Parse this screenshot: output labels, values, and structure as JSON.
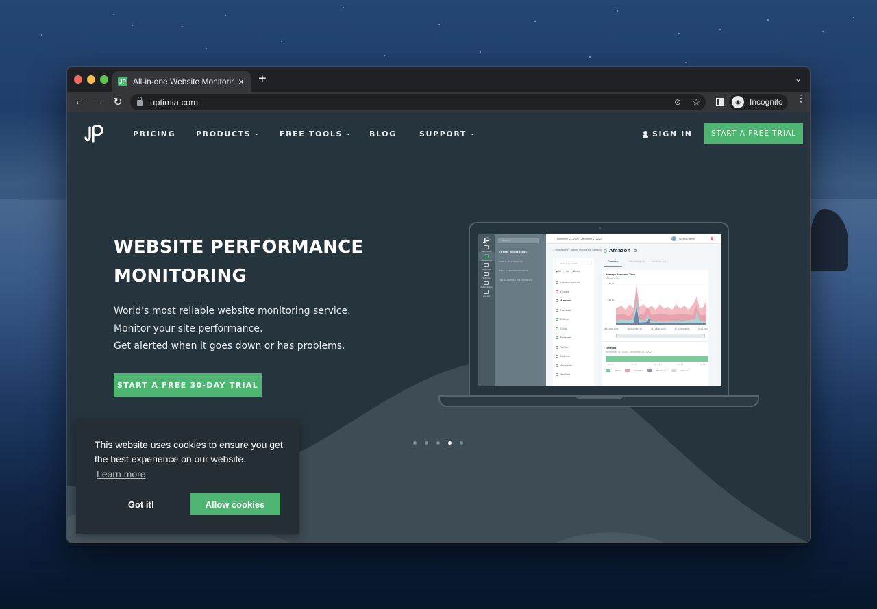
{
  "browser": {
    "tab_title": "All-in-one Website Monitoring",
    "tab_favicon_text": "JP",
    "url": "uptimia.com",
    "profile_label": "Incognito",
    "icons": {
      "close": "×",
      "new_tab": "+",
      "tab_list": "⌄",
      "back": "←",
      "forward": "→",
      "reload": "↻",
      "eye_off": "⊘",
      "star": "☆",
      "menu": "⋮",
      "incognito": "◉"
    }
  },
  "site": {
    "brand_color": "#4eb573",
    "background_color": "#26343e",
    "nav": [
      {
        "label": "PRICING",
        "has_dropdown": false
      },
      {
        "label": "PRODUCTS",
        "has_dropdown": true
      },
      {
        "label": "FREE TOOLS",
        "has_dropdown": true
      },
      {
        "label": "BLOG",
        "has_dropdown": false
      },
      {
        "label": "SUPPORT",
        "has_dropdown": true
      }
    ],
    "chevron": "⌄",
    "sign_in": "SIGN IN",
    "cta_top": "START A FREE TRIAL",
    "hero": {
      "title_line1": "WEBSITE PERFORMANCE",
      "title_line2": "MONITORING",
      "sub_lines": [
        "World's most reliable website monitoring service.",
        "Monitor your site performance.",
        "Get alerted when it goes down or has problems."
      ],
      "cta": "START A FREE 30-DAY TRIAL"
    },
    "carousel": {
      "total": 5,
      "active_index": 3
    }
  },
  "mockup": {
    "rail_items": [
      "Dashboard",
      "Monitoring",
      "Reporting",
      "Settings",
      "Subscription",
      "Log out"
    ],
    "search_placeholder": "Search",
    "menu_items": [
      "UPTIME MONITORING",
      "SPEED MONITORING",
      "REAL USER MONITORING",
      "TRANSACTION MONITORING"
    ],
    "date_range": "November 24, 2020 - December 1, 2020",
    "user": "Uptimia Demo",
    "breadcrumb": [
      "Monitoring",
      "Uptime monitoring",
      "Amazon"
    ],
    "list_search": "Search by name...",
    "filters": [
      "All",
      "Up",
      "Down"
    ],
    "monitors": [
      {
        "name": "ADD NEW MONITOR",
        "status": "add"
      },
      {
        "name": "Google",
        "status": "down"
      },
      {
        "name": "Amazon",
        "status": "up"
      },
      {
        "name": "Facebook",
        "status": "up"
      },
      {
        "name": "Github",
        "status": "up"
      },
      {
        "name": "GMail",
        "status": "up"
      },
      {
        "name": "Pinterest",
        "status": "up"
      },
      {
        "name": "Twitter",
        "status": "up"
      },
      {
        "name": "Uptimia",
        "status": "up"
      },
      {
        "name": "Wikipedia",
        "status": "up"
      },
      {
        "name": "YouTube",
        "status": "up"
      }
    ],
    "monitor_title": "Amazon",
    "tabs": [
      "Summary",
      "Monitoring log",
      "Incidents log"
    ],
    "chart_title": "Average Response Time",
    "chart_unit": "Milliseconds",
    "y_ticks": [
      "150 ms",
      "100 ms"
    ],
    "x_ticks": [
      "26.11.2020 12:00",
      "28.11.2020 01:00",
      "29.11.2020 12:00",
      "01.12.2020 00:00",
      "01.12.2020"
    ],
    "timeline_title": "Timeline",
    "timeline_range": "November 24, 2020 - December 01, 2020",
    "timeline_ticks": [
      "Nov 25",
      "Nov 26",
      "Nov 28",
      "Nov 29",
      "Nov 30"
    ],
    "legend": [
      "Uptime",
      "Downtime",
      "Maintenance",
      "Unknown"
    ]
  },
  "cookie": {
    "message": "This website uses cookies to ensure you get the best experience on our website.",
    "learn_more": "Learn more",
    "dismiss": "Got it!",
    "allow": "Allow cookies"
  }
}
